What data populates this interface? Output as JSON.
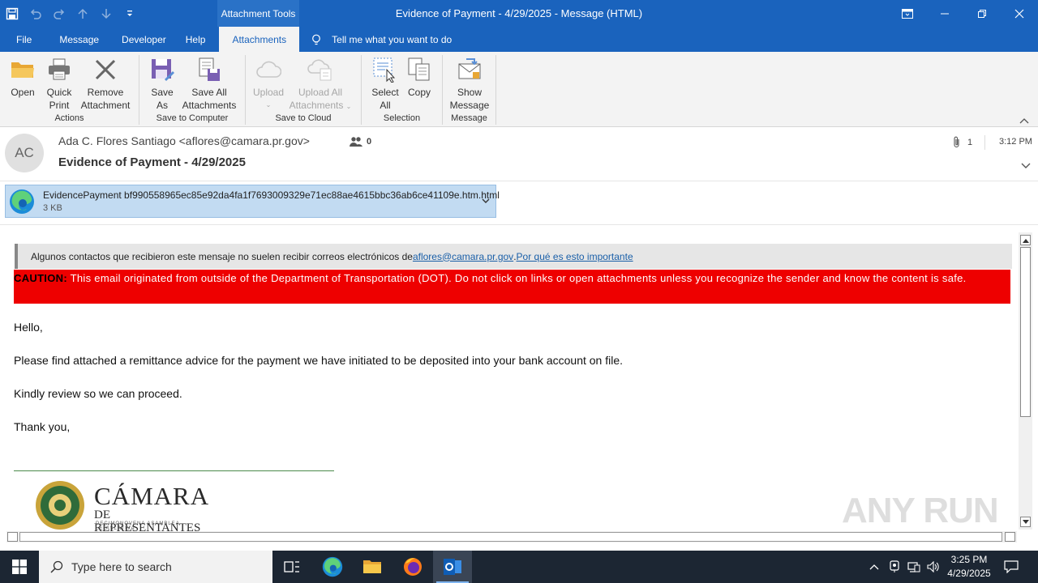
{
  "window": {
    "context_tab": "Attachment Tools",
    "title": "Evidence of Payment - 4/29/2025  -  Message (HTML)"
  },
  "menu": {
    "tabs": [
      "File",
      "Message",
      "Developer",
      "Help",
      "Attachments"
    ],
    "active_tab": "Attachments",
    "tell_me": "Tell me what you want to do"
  },
  "ribbon": {
    "open": "Open",
    "quick_print_1": "Quick",
    "quick_print_2": "Print",
    "remove_1": "Remove",
    "remove_2": "Attachment",
    "actions_label": "Actions",
    "save_as_1": "Save",
    "save_as_2": "As",
    "save_all_1": "Save All",
    "save_all_2": "Attachments",
    "save_to_computer_label": "Save to Computer",
    "upload": "Upload",
    "upload_all_1": "Upload All",
    "upload_all_2": "Attachments",
    "save_to_cloud_label": "Save to Cloud",
    "select_all_1": "Select",
    "select_all_2": "All",
    "copy": "Copy",
    "selection_label": "Selection",
    "show_message_1": "Show",
    "show_message_2": "Message",
    "message_label": "Message"
  },
  "header": {
    "avatar_initials": "AC",
    "sender": "Ada C. Flores Santiago <aflores@camara.pr.gov>",
    "people_count": "0",
    "subject": "Evidence of Payment - 4/29/2025",
    "attachment_count": "1",
    "time": "3:12 PM"
  },
  "attachment": {
    "filename": "EvidencePayment bf990558965ec85e92da4fa1f7693009329e71ec88ae4615bbc36ab6ce41109e.htm.html",
    "size": "3 KB"
  },
  "body": {
    "notice_text": "Algunos contactos que recibieron este mensaje no suelen recibir correos electrónicos de ",
    "notice_email": "aflores@camara.pr.gov",
    "notice_sep": ". ",
    "notice_link": "Por qué es esto importante",
    "caution_label": "CAUTION:",
    "caution_text": " This email originated from outside of the Department of Transportation (DOT). Do not click on links or open attachments unless you recognize the sender and know the content is safe.",
    "greeting": "Hello,",
    "para1": "Please find attached a remittance advice for the payment we have initiated to be deposited into your bank account on file.",
    "para2": "Kindly review so we can proceed.",
    "closing": "Thank you,",
    "logo_title": "CÁMARA",
    "logo_subtitle": "DE REPRESENTANTES",
    "logo_tagline": "DECIMONOVENA ASAMBLEA LEGISLATIVA"
  },
  "watermark": "ANY RUN",
  "taskbar": {
    "search_placeholder": "Type here to search",
    "clock_time": "3:25 PM",
    "clock_date": "4/29/2025"
  },
  "colors": {
    "accent": "#1a63bd",
    "caution_bg": "#ee0000",
    "attachment_bg": "#c2dbf2",
    "taskbar_bg": "#1c2633"
  }
}
